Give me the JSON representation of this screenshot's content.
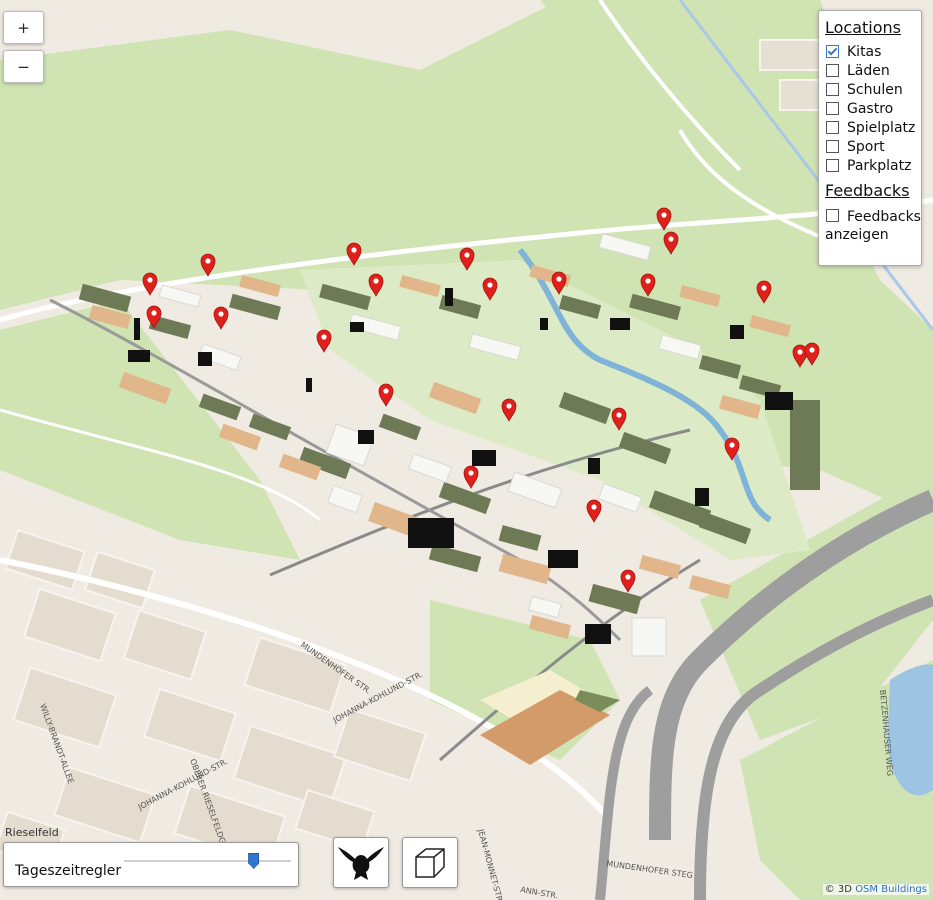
{
  "zoom": {
    "in_label": "+",
    "out_label": "−"
  },
  "layers": {
    "title": "Locations",
    "items": [
      {
        "label": "Kitas",
        "checked": true
      },
      {
        "label": "Läden",
        "checked": false
      },
      {
        "label": "Schulen",
        "checked": false
      },
      {
        "label": "Gastro",
        "checked": false
      },
      {
        "label": "Spielplatz",
        "checked": false
      },
      {
        "label": "Sport",
        "checked": false
      },
      {
        "label": "Parkplatz",
        "checked": false
      }
    ]
  },
  "feedbacks": {
    "title": "Feedbacks",
    "toggle_label": "Feedbacks anzeigen",
    "checked": false
  },
  "time_control": {
    "label": "Tageszeitregler",
    "value_fraction": 0.78
  },
  "view_buttons": {
    "bird_icon": "bird-view-icon",
    "cube_icon": "cube-3d-icon"
  },
  "attribution": {
    "prefix": "© 3D",
    "link": "OSM Buildings"
  },
  "map": {
    "street_labels": [
      "MUNDENHOFER STR.",
      "JOHANNA-KOHLUND-STR.",
      "JOHANNA-KOHLUND-STR.",
      "WILLY-BRANDT-ALLEE",
      "OBERER RIESELFELDGRABEN",
      "JEAN-MONNET-STR.",
      "BETZENHAUSER WEG",
      "MUNDENHOFER STEG",
      "Rieselfeld",
      "ANN-STR."
    ],
    "colors": {
      "background": "#efeae2",
      "green": "#cde4b0",
      "water": "#9dc4e3",
      "marker": "#e0201b",
      "building_olive": "#6e7a55",
      "building_tan": "#e0b68a"
    }
  }
}
